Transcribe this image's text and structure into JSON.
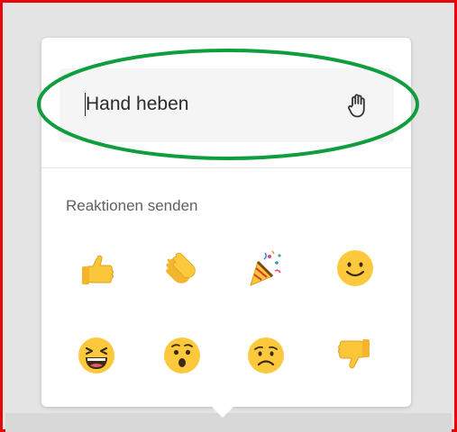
{
  "menu": {
    "hand_raise_label": "Hand heben",
    "hand_icon": "hand-raise-icon",
    "reactions_title": "Reaktionen senden",
    "reactions": [
      {
        "name": "like",
        "icon": "thumbs-up-icon"
      },
      {
        "name": "applause",
        "icon": "clapping-hands-icon"
      },
      {
        "name": "celebrate",
        "icon": "party-popper-icon"
      },
      {
        "name": "smile",
        "icon": "smiling-face-icon"
      },
      {
        "name": "laugh",
        "icon": "laughing-face-icon"
      },
      {
        "name": "surprised",
        "icon": "surprised-face-icon"
      },
      {
        "name": "sad",
        "icon": "sad-face-icon"
      },
      {
        "name": "dislike",
        "icon": "thumbs-down-icon"
      }
    ]
  },
  "colors": {
    "frame_border": "#e8060b",
    "highlight_ellipse": "#0f9d3d",
    "emoji_yellow": "#fdc93c",
    "emoji_dark": "#3d2a12"
  }
}
